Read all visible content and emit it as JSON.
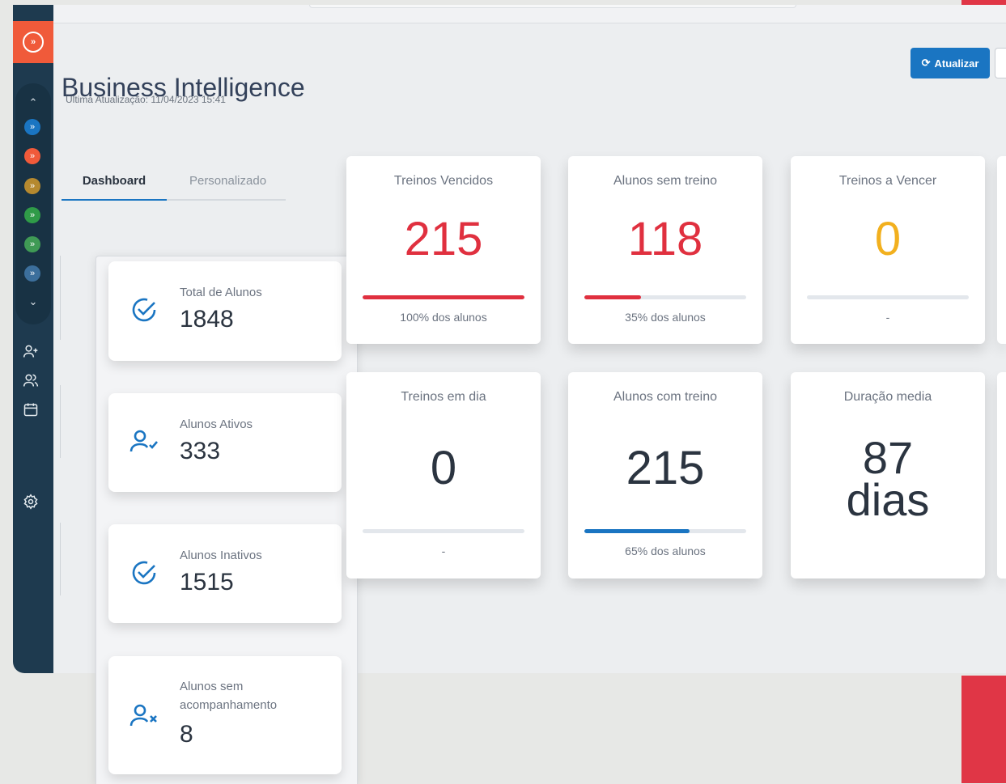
{
  "header": {
    "title": "Business Intelligence",
    "last_update": "Última Atualização: 11/04/2023 15:41",
    "refresh_label": "Atualizar"
  },
  "tabs": [
    {
      "label": "Dashboard",
      "active": true
    },
    {
      "label": "Personalizado",
      "active": false
    }
  ],
  "sidebar": {
    "modules": [
      {
        "color": "#1a75c2"
      },
      {
        "color": "#f05a3a"
      },
      {
        "color": "#b5892f"
      },
      {
        "color": "#2f9b48"
      },
      {
        "color": "#3f9a55"
      },
      {
        "color": "#3c6f9c"
      }
    ],
    "icons": [
      "add-user-icon",
      "users-icon",
      "calendar-icon",
      "settings-icon"
    ]
  },
  "stats": [
    {
      "label": "Total de Alunos",
      "value": "1848",
      "icon": "check-circle-icon"
    },
    {
      "label": "Alunos Ativos",
      "value": "333",
      "icon": "user-check-icon"
    },
    {
      "label": "Alunos Inativos",
      "value": "1515",
      "icon": "check-circle-icon"
    },
    {
      "label": "Alunos sem acompanhamento",
      "value": "8",
      "icon": "user-x-icon"
    }
  ],
  "kpis": [
    {
      "label": "Treinos Vencidos",
      "value": "215",
      "sub": "100% dos alunos",
      "progress": 1.0,
      "color": "#e0303f",
      "bar_color": "#e0303f"
    },
    {
      "label": "Alunos sem treino",
      "value": "118",
      "sub": "35% dos alunos",
      "progress": 0.35,
      "color": "#e0303f",
      "bar_color": "#e0303f"
    },
    {
      "label": "Treinos a Vencer",
      "value": "0",
      "sub": "-",
      "progress": 0,
      "color": "#f2b01e",
      "bar_color": "#f2b01e"
    },
    {
      "label": "Treinos em dia",
      "value": "0",
      "sub": "-",
      "progress": 0,
      "color": "#2b3440",
      "bar_color": "#1a75c2"
    },
    {
      "label": "Alunos com treino",
      "value": "215",
      "sub": "65% dos alunos",
      "progress": 0.65,
      "color": "#2b3440",
      "bar_color": "#1a75c2"
    },
    {
      "label": "Duração media",
      "value": "87",
      "value_unit": "dias",
      "color": "#2b3440"
    }
  ]
}
